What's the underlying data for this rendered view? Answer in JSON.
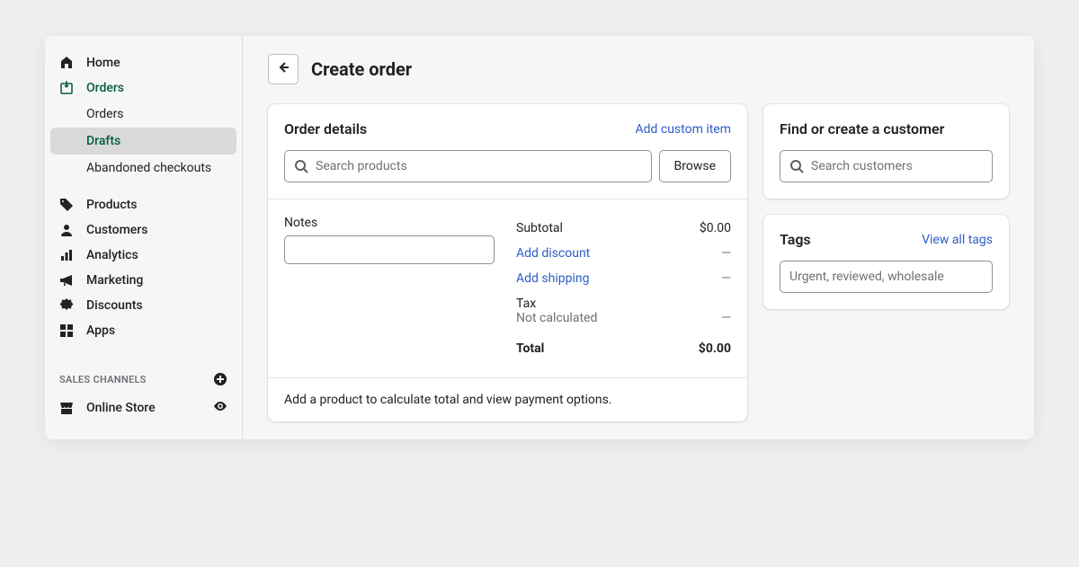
{
  "sidebar": {
    "items": [
      {
        "label": "Home",
        "icon": "home"
      },
      {
        "label": "Orders",
        "icon": "orders"
      },
      {
        "label": "Products",
        "icon": "tag"
      },
      {
        "label": "Customers",
        "icon": "person"
      },
      {
        "label": "Analytics",
        "icon": "bars"
      },
      {
        "label": "Marketing",
        "icon": "megaphone"
      },
      {
        "label": "Discounts",
        "icon": "badge"
      },
      {
        "label": "Apps",
        "icon": "grid"
      }
    ],
    "orders_subitems": [
      {
        "label": "Orders"
      },
      {
        "label": "Drafts",
        "selected": true
      },
      {
        "label": "Abandoned checkouts"
      }
    ],
    "sales_channels_label": "SALES CHANNELS",
    "channels": [
      {
        "label": "Online Store",
        "icon": "store"
      }
    ]
  },
  "header": {
    "title": "Create order"
  },
  "order_details": {
    "title": "Order details",
    "add_custom_link": "Add custom item",
    "search_placeholder": "Search products",
    "browse_label": "Browse",
    "notes_label": "Notes",
    "notes_value": "",
    "subtotal_label": "Subtotal",
    "subtotal_value": "$0.00",
    "discount_label": "Add discount",
    "discount_value": "—",
    "shipping_label": "Add shipping",
    "shipping_value": "—",
    "tax_label": "Tax",
    "tax_sub": "Not calculated",
    "tax_value": "—",
    "total_label": "Total",
    "total_value": "$0.00",
    "footer_message": "Add a product to calculate total and view payment options."
  },
  "customer": {
    "title": "Find or create a customer",
    "search_placeholder": "Search customers"
  },
  "tags": {
    "title": "Tags",
    "view_all_link": "View all tags",
    "placeholder": "Urgent, reviewed, wholesale"
  }
}
